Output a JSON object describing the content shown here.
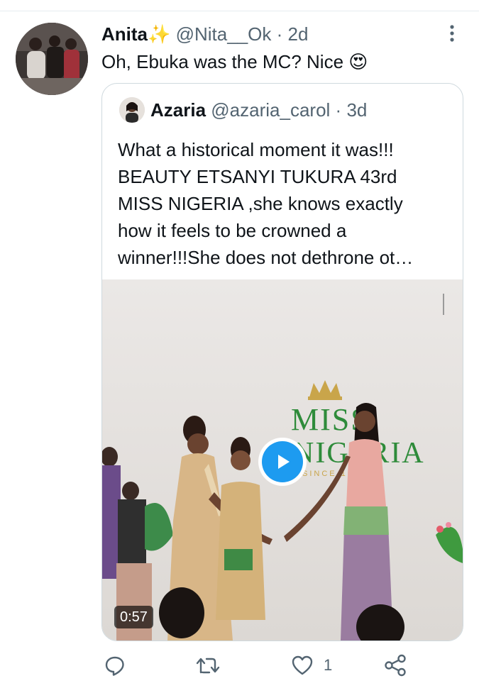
{
  "tweet": {
    "author_name": "Anita✨",
    "handle": "@Nita__Ok",
    "separator": "·",
    "time": "2d",
    "text": "Oh, Ebuka was the MC? Nice 😍"
  },
  "quoted_tweet": {
    "author_name": "Azaria",
    "handle": "@azaria_carol",
    "separator": "·",
    "time": "3d",
    "text": "What a historical moment it was!!!\nBEAUTY ETSANYI TUKURA 43rd\nMISS NIGERIA ,she knows exactly\nhow it feels to be crowned a\nwinner!!!She does not dethrone ot…",
    "video": {
      "duration": "0:57",
      "backdrop_text_line1": "MISS",
      "backdrop_text_line2": "NIGERIA",
      "backdrop_text_line3": "SINCE 1957"
    }
  },
  "actions": {
    "reply_icon": "reply-icon",
    "retweet_icon": "retweet-icon",
    "like_icon": "heart-icon",
    "like_count": "1",
    "share_icon": "share-icon"
  },
  "colors": {
    "accent": "#1d9bf0",
    "secondary_text": "#536471",
    "brand_green": "#2e8b3a"
  }
}
